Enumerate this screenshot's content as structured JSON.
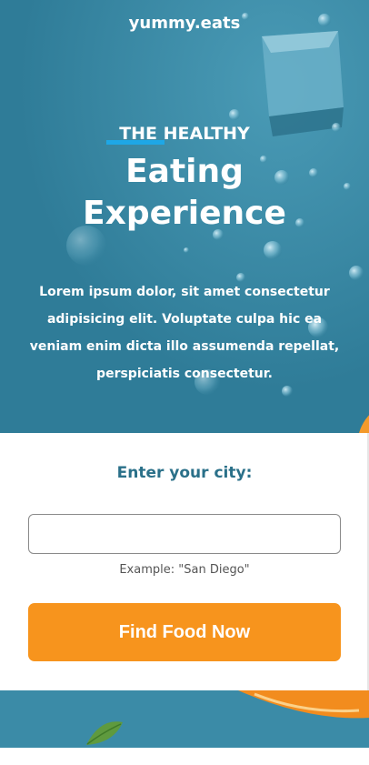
{
  "brand": {
    "name": "yummy.eats"
  },
  "hero": {
    "kicker": "THE HEALTHY",
    "headline_line1": "Eating",
    "headline_line2": "Experience",
    "description": "Lorem ipsum dolor, sit amet consectetur adipisicing elit. Voluptate culpa hic ea veniam enim dicta illo assumenda repellat, perspiciatis consectetur."
  },
  "form": {
    "label": "Enter your city:",
    "city_input": {
      "value": "",
      "placeholder": ""
    },
    "example": "Example: \"San Diego\"",
    "submit_label": "Find Food Now"
  },
  "colors": {
    "hero_bg": "#3a8aa6",
    "accent_underline": "#1ea7e6",
    "label_text": "#2a7089",
    "cta_bg": "#f7941d"
  }
}
